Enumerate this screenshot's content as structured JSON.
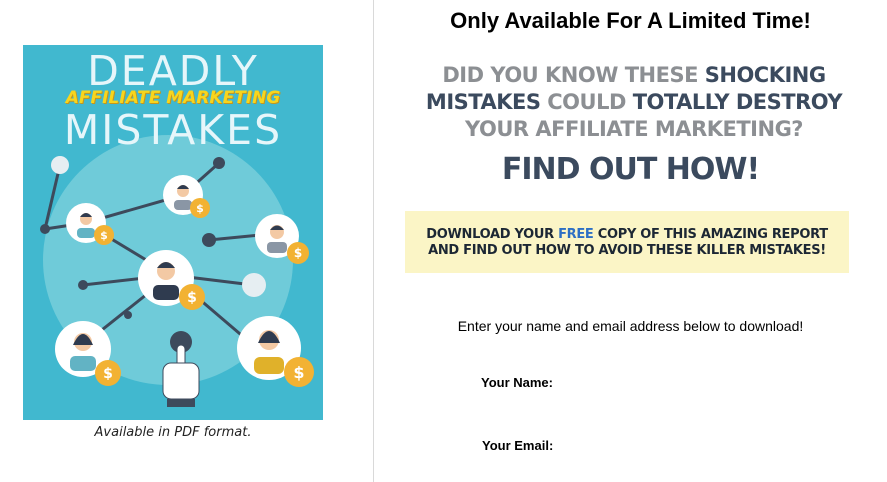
{
  "left": {
    "cover": {
      "title_line1": "DEADLY",
      "title_line2": "AFFILIATE MARKETING",
      "title_line3": "MISTAKES",
      "background_color": "#41b8cf",
      "icons": [
        "network-node-icon",
        "person-avatar-icon",
        "dollar-coin-icon",
        "pointing-hand-icon"
      ]
    },
    "caption": "Available in PDF format."
  },
  "right": {
    "limited_time": "Only Available For A Limited Time!",
    "headline": {
      "part1": "DID YOU KNOW THESE ",
      "part2": "SHOCKING",
      "part3": "MISTAKES",
      "part4": " COULD ",
      "part5": "TOTALLY DESTROY",
      "part6": "YOUR AFFILIATE MARKETING?"
    },
    "find_out": "FIND OUT HOW!",
    "download_box": {
      "line1_a": "DOWNLOAD YOUR ",
      "line1_b": "FREE",
      "line1_c": " COPY OF THIS AMAZING REPORT",
      "line2": "AND FIND OUT HOW TO AVOID THESE KILLER MISTAKES!",
      "background_color": "#fbf5c6"
    },
    "enter_text": "Enter your name and email address below to download!",
    "form": {
      "name_label": "Your Name:",
      "email_label": "Your Email:"
    }
  }
}
